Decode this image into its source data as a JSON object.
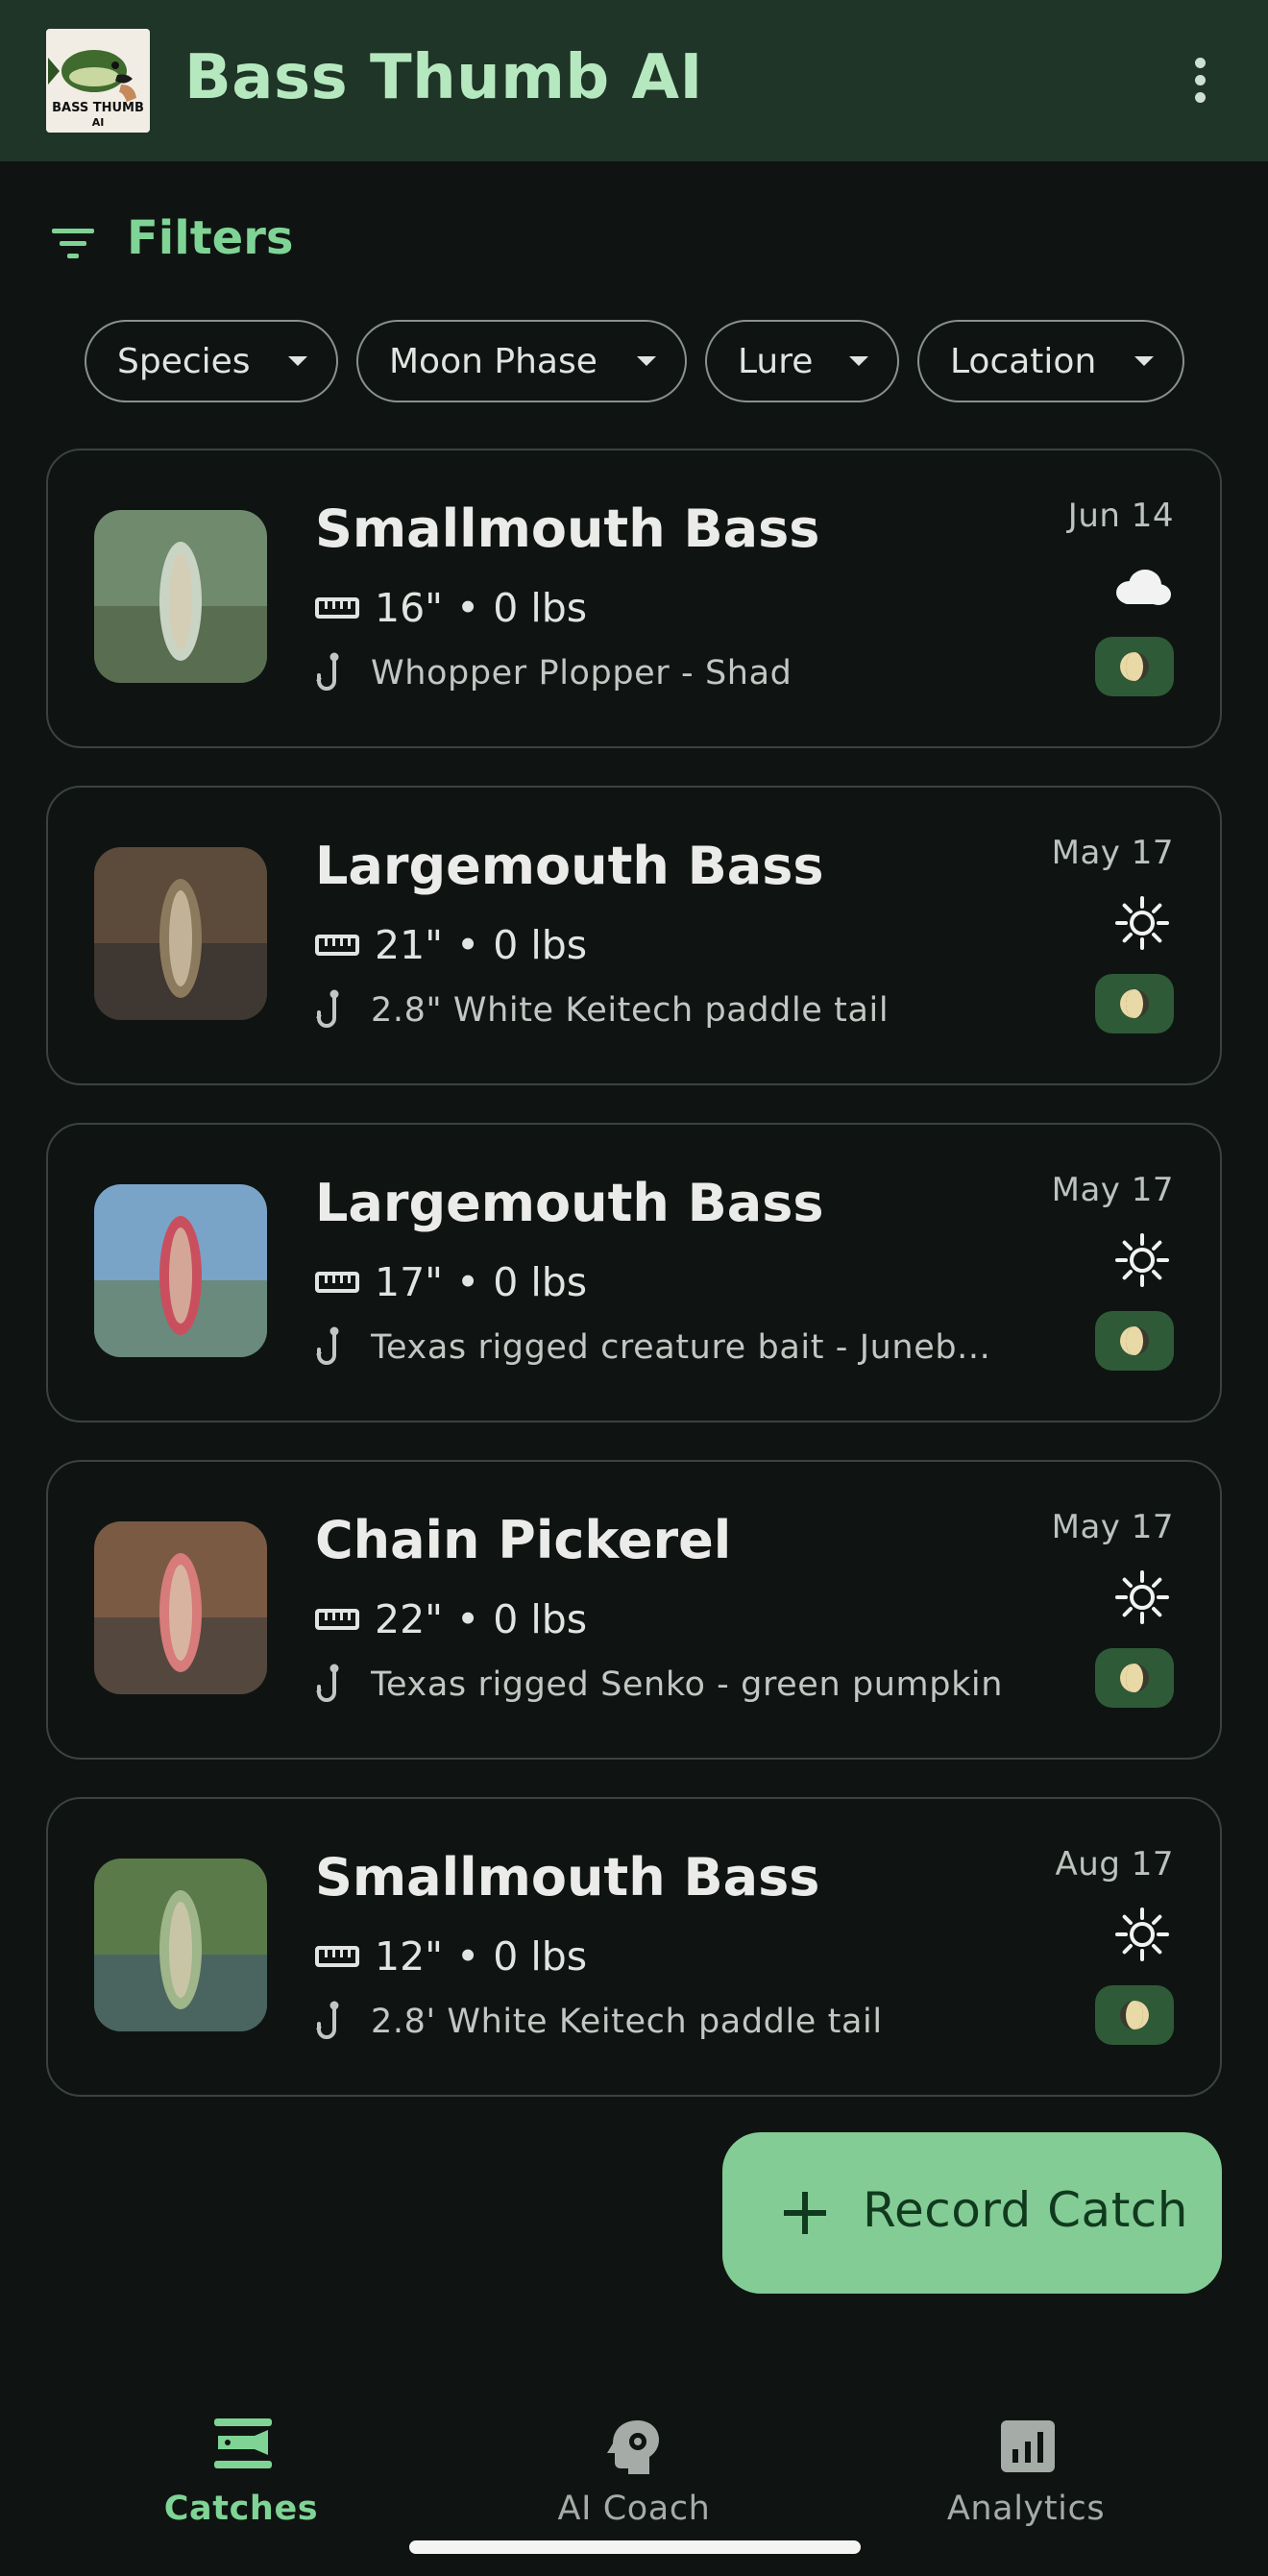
{
  "app": {
    "title": "Bass Thumb AI",
    "logo_text_line1": "BASS THUMB",
    "logo_text_line2": "AI",
    "more_icon": "more-vert-icon"
  },
  "filters": {
    "label": "Filters",
    "icon": "filter-list-icon",
    "chips": [
      {
        "label": "Species"
      },
      {
        "label": "Moon Phase"
      },
      {
        "label": "Lure"
      },
      {
        "label": "Location"
      }
    ]
  },
  "catches": [
    {
      "species": "Smallmouth Bass",
      "length": "16\"",
      "weight": "0 lbs",
      "lure": "Whopper Plopper - Shad",
      "date": "Jun 14",
      "weather": "cloud",
      "moon": "waxing-gibbous"
    },
    {
      "species": "Largemouth Bass",
      "length": "21\"",
      "weight": "0 lbs",
      "lure": "2.8\" White Keitech paddle tail",
      "date": "May 17",
      "weather": "sun",
      "moon": "waxing-gibbous"
    },
    {
      "species": "Largemouth Bass",
      "length": "17\"",
      "weight": "0 lbs",
      "lure": "Texas rigged creature bait - Juneb...",
      "date": "May 17",
      "weather": "sun",
      "moon": "waxing-gibbous"
    },
    {
      "species": "Chain Pickerel",
      "length": "22\"",
      "weight": "0 lbs",
      "lure": "Texas rigged Senko - green pumpkin",
      "date": "May 17",
      "weather": "sun",
      "moon": "waxing-gibbous"
    },
    {
      "species": "Smallmouth Bass",
      "length": "12\"",
      "weight": "0 lbs",
      "lure": "2.8' White Keitech paddle tail",
      "date": "Aug 17",
      "weather": "sun",
      "moon": "waning-gibbous"
    }
  ],
  "fab": {
    "label": "Record Catch"
  },
  "nav": {
    "items": [
      {
        "label": "Catches",
        "icon": "fish-icon",
        "active": true
      },
      {
        "label": "AI Coach",
        "icon": "psychology-icon",
        "active": false
      },
      {
        "label": "Analytics",
        "icon": "analytics-icon",
        "active": false
      }
    ]
  },
  "colors": {
    "appbar": "#1f3527",
    "accent": "#7fd495",
    "fab": "#84cc95",
    "background": "#0f1412"
  }
}
